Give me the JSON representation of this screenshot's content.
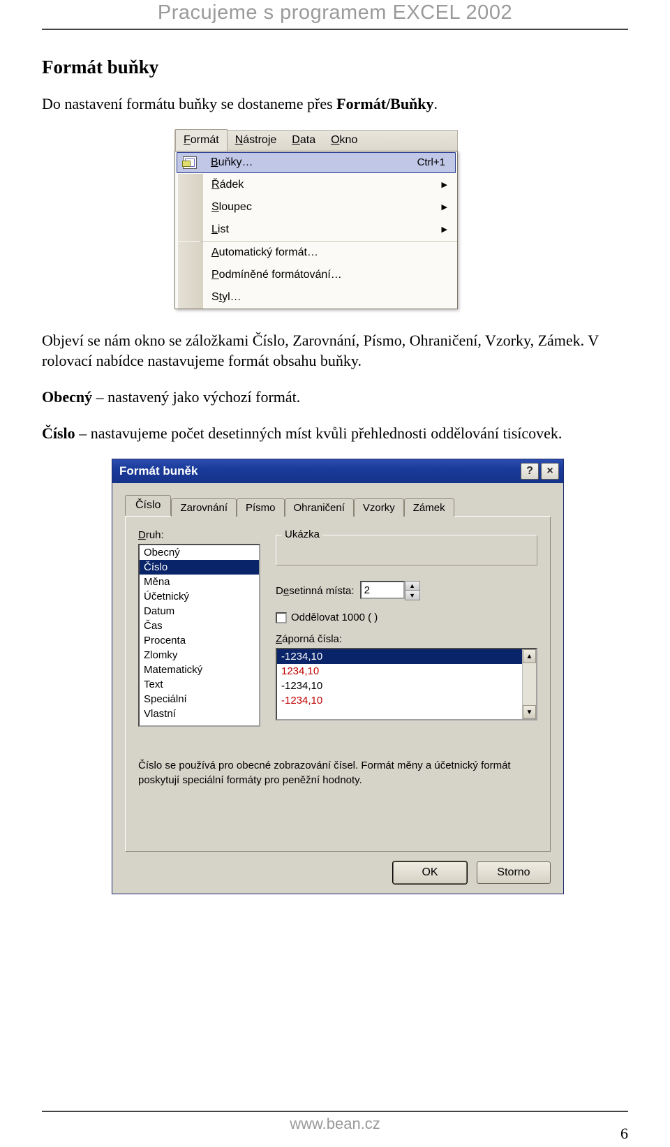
{
  "header": {
    "title": "Pracujeme s programem EXCEL 2002"
  },
  "section": {
    "heading": "Formát buňky"
  },
  "paragraphs": {
    "p1a": "Do nastavení formátu buňky se dostaneme přes ",
    "p1b": "Formát/Buňky",
    "p1c": ".",
    "p2": "Objeví se nám okno se záložkami Číslo, Zarovnání, Písmo, Ohraničení, Vzorky, Zámek. V rolovací nabídce nastavujeme formát obsahu buňky.",
    "p3a": "Obecný",
    "p3b": " – nastavený jako výchozí formát.",
    "p4a": "Číslo",
    "p4b": " – nastavujeme počet desetinných míst kvůli přehlednosti oddělování tisícovek."
  },
  "menubar": {
    "items": [
      "Formát",
      "Nástroje",
      "Data",
      "Okno"
    ],
    "underlines": [
      "F",
      "N",
      "D",
      "O"
    ]
  },
  "dropdown": {
    "rows": [
      {
        "label": "Buňky…",
        "ul": "B",
        "shortcut": "Ctrl+1",
        "selected": true,
        "icon": true
      },
      {
        "label": "Řádek",
        "ul": "Ř",
        "submenu": true
      },
      {
        "label": "Sloupec",
        "ul": "S",
        "submenu": true
      },
      {
        "label": "List",
        "ul": "L",
        "submenu": true
      },
      {
        "sep": true
      },
      {
        "label": "Automatický formát…",
        "ul": "A"
      },
      {
        "label": "Podmíněné formátování…",
        "ul": "P"
      },
      {
        "label": "Styl…",
        "ul": "t"
      }
    ]
  },
  "dialog": {
    "title": "Formát buněk",
    "help": "?",
    "close": "×",
    "tabs": [
      "Číslo",
      "Zarovnání",
      "Písmo",
      "Ohraničení",
      "Vzorky",
      "Zámek"
    ],
    "active_tab": 0,
    "druh_label": "Druh:",
    "druh_items": [
      "Obecný",
      "Číslo",
      "Měna",
      "Účetnický",
      "Datum",
      "Čas",
      "Procenta",
      "Zlomky",
      "Matematický",
      "Text",
      "Speciální",
      "Vlastní"
    ],
    "druh_selected": 1,
    "ukazka_label": "Ukázka",
    "decimal_label": "Desetinná místa:",
    "decimal_value": "2",
    "thousand_label": "Oddělovat 1000 ( )",
    "neg_label": "Záporná čísla:",
    "neg_items": [
      {
        "text": "-1234,10",
        "selected": true
      },
      {
        "text": "1234,10",
        "red": true
      },
      {
        "text": "-1234,10"
      },
      {
        "text": "-1234,10",
        "red": true
      }
    ],
    "description": "Číslo se používá pro obecné zobrazování čísel. Formát měny a účetnický formát poskytují speciální formáty pro peněžní hodnoty.",
    "ok": "OK",
    "cancel": "Storno"
  },
  "footer": {
    "url": "www.bean.cz",
    "page": "6"
  }
}
